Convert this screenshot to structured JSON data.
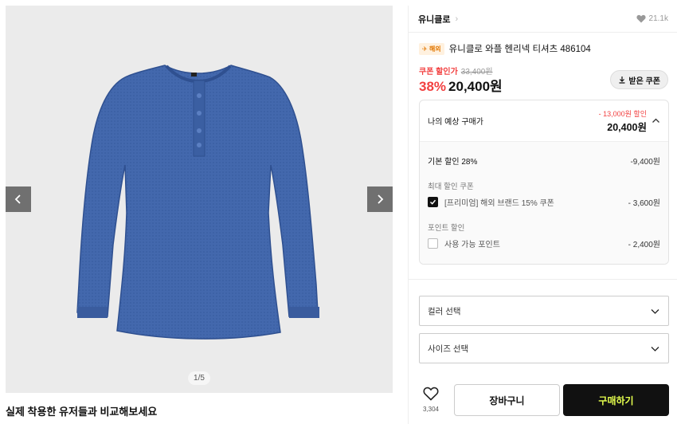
{
  "gallery": {
    "counter": "1/5",
    "compare_title": "실제 착용한 유저들과 비교해보세요"
  },
  "brand": {
    "name": "유니클로",
    "like_count": "21.1k"
  },
  "product": {
    "badge": "해외",
    "name": "유니클로 와플 헨리넥 티셔츠 486104"
  },
  "price": {
    "coupon_label": "쿠폰 할인가",
    "original": "33,400원",
    "rate": "38%",
    "final": "20,400원",
    "coupon_button": "받은 쿠폰"
  },
  "estimate": {
    "title": "나의 예상 구매가",
    "discount_total": "- 13,000원 할인",
    "price": "20,400원",
    "base_discount_label": "기본 할인 28%",
    "base_discount_amount": "-9,400원",
    "max_coupon_label": "최대 할인 쿠폰",
    "coupon_item_label": "[프리미엄] 해외 브랜드 15% 쿠폰",
    "coupon_item_amount": "- 3,600원",
    "point_section_label": "포인트 할인",
    "point_item_label": "사용 가능 포인트",
    "point_item_amount": "- 2,400원"
  },
  "options": {
    "color_placeholder": "컬러 선택",
    "size_placeholder": "사이즈 선택"
  },
  "actions": {
    "wish_count": "3,304",
    "cart_label": "장바구니",
    "buy_label": "구매하기"
  },
  "colors": {
    "accent_red": "#f23f3f",
    "buy_text": "#e6ff4e",
    "shirt_blue": "#3f64a8"
  }
}
